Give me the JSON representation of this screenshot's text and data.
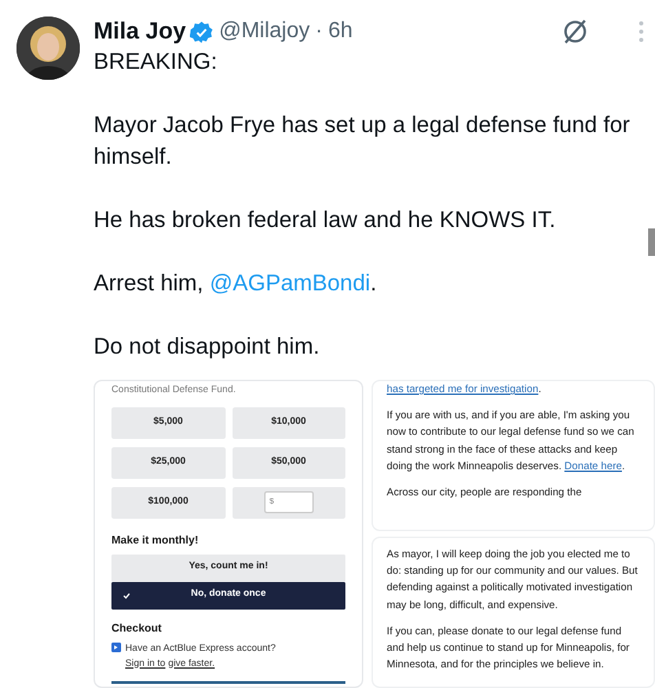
{
  "post": {
    "author": "Mila Joy",
    "verified": true,
    "handle": "@Milajoy",
    "separator": "·",
    "time": "6h",
    "paragraphs": [
      [
        {
          "kind": "text",
          "text": "BREAKING:"
        }
      ],
      [
        {
          "kind": "text",
          "text": "Mayor Jacob Frye has set up a legal defense fund for himself."
        }
      ],
      [
        {
          "kind": "text",
          "text": "He has broken federal law and he KNOWS IT."
        }
      ],
      [
        {
          "kind": "text",
          "text": "Arrest him, "
        },
        {
          "kind": "mention",
          "text": "@AGPamBondi"
        },
        {
          "kind": "text",
          "text": "."
        }
      ],
      [
        {
          "kind": "text",
          "text": "Do not disappoint him."
        }
      ]
    ]
  },
  "donation_form": {
    "intro": "Constitutional Defense Fund.",
    "amounts": [
      "$5,000",
      "$10,000",
      "$25,000",
      "$50,000",
      "$100,000"
    ],
    "custom_amount": {
      "placeholder": "$"
    },
    "monthly_heading": "Make it monthly!",
    "options": [
      {
        "label": "Yes, count me in!",
        "selected": false
      },
      {
        "label": "No, donate once",
        "selected": true
      }
    ],
    "checkout_heading": "Checkout",
    "express": [
      {
        "kind": "text",
        "text": "Have an ActBlue Express account? "
      },
      {
        "kind": "link",
        "text": "Sign in to"
      },
      {
        "kind": "link",
        "text": "give faster."
      }
    ]
  },
  "letter": {
    "cards": [
      [
        [
          {
            "kind": "link",
            "text": "has targeted me for investigation"
          },
          {
            "kind": "text",
            "text": "."
          }
        ],
        [
          {
            "kind": "text",
            "text": "If you are with us, and if you are able, I'm asking you now to contribute to our legal defense fund so we can stand strong in the face of these attacks and keep doing the work Minneapolis deserves. "
          },
          {
            "kind": "link",
            "text": "Donate here"
          },
          {
            "kind": "text",
            "text": "."
          }
        ],
        [
          {
            "kind": "text",
            "text": "Across our city, people are responding the"
          }
        ]
      ],
      [
        [
          {
            "kind": "text",
            "text": "As mayor, I will keep doing the job you elected me to do: standing up for our community and our values. But defending against a politically motivated investigation may be long, difficult, and expensive."
          }
        ],
        [
          {
            "kind": "text",
            "text": "If you can, please donate to our legal defense fund and help us continue to stand up for Minneapolis, for Minnesota, and for the principles we believe in."
          }
        ]
      ]
    ]
  }
}
